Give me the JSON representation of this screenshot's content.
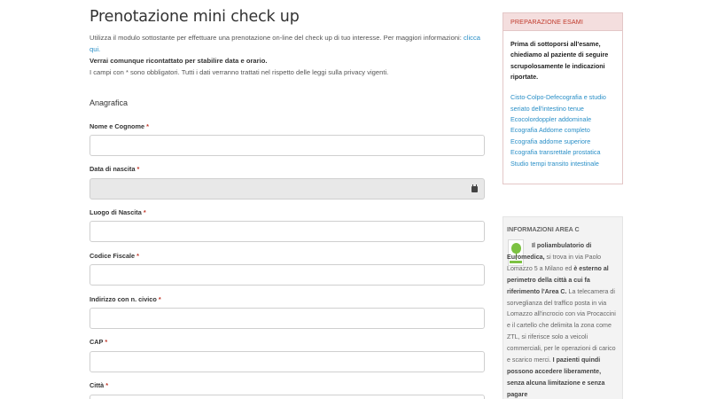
{
  "main": {
    "title": "Prenotazione mini check up",
    "intro_text": "Utilizza il modulo sottostante per effettuare una prenotazione on-line del check up di tuo interesse. Per maggiori informazioni:",
    "intro_link": "clicca qui.",
    "intro_bold": "Verrai comunque ricontattato per stabilire data e orario.",
    "intro_note": "I campi con * sono obbligatori. Tutti i dati verranno trattati nel rispetto delle leggi sulla privacy vigenti.",
    "section_title": "Anagrafica",
    "required_mark": "*",
    "fields": [
      {
        "label": "Nome e Cognome",
        "value": ""
      },
      {
        "label": "Data di nascita",
        "value": ""
      },
      {
        "label": "Luogo di Nascita",
        "value": ""
      },
      {
        "label": "Codice Fiscale",
        "value": ""
      },
      {
        "label": "Indirizzo con n. civico",
        "value": ""
      },
      {
        "label": "CAP",
        "value": ""
      },
      {
        "label": "Città",
        "value": ""
      }
    ],
    "date_field_icon": "calendar-icon"
  },
  "sidebar": {
    "exam_box": {
      "title": "PREPARAZIONE ESAMI",
      "text": "Prima di sottoporsi all'esame, chiediamo al paziente di seguire scrupolosamente le indicazioni riportate.",
      "links": [
        "Cisto-Colpo-Defecografia e studio seriato dell'intestino tenue",
        "Ecocolordoppler addominale",
        "Ecografia Addome completo",
        "Ecografia addome superiore",
        "Ecografia transrettale prostatica",
        "Studio tempi transito intestinale"
      ]
    },
    "area_c": {
      "title": "INFORMAZIONI AREA C",
      "p1a": "Il poliambulatorio di Euromedica,",
      "p1b": " si trova in via Paolo Lomazzo 5 a Milano ed ",
      "p1c": "è esterno al perimetro della città a cui fa riferimento l'Area C.",
      "p2": " La telecamera di sorveglianza del traffico posta in via Lomazzo all'incrocio con via Procaccini e il cartello che delimita la zona come ZTL, si riferisce solo a veicoli commerciali, per le operazioni di carico e scarico merci. ",
      "p3": "I pazienti quindi possono accedere liberamente, senza alcuna limitazione e senza pagare",
      "logo_icon": "area-c-logo-icon"
    }
  }
}
